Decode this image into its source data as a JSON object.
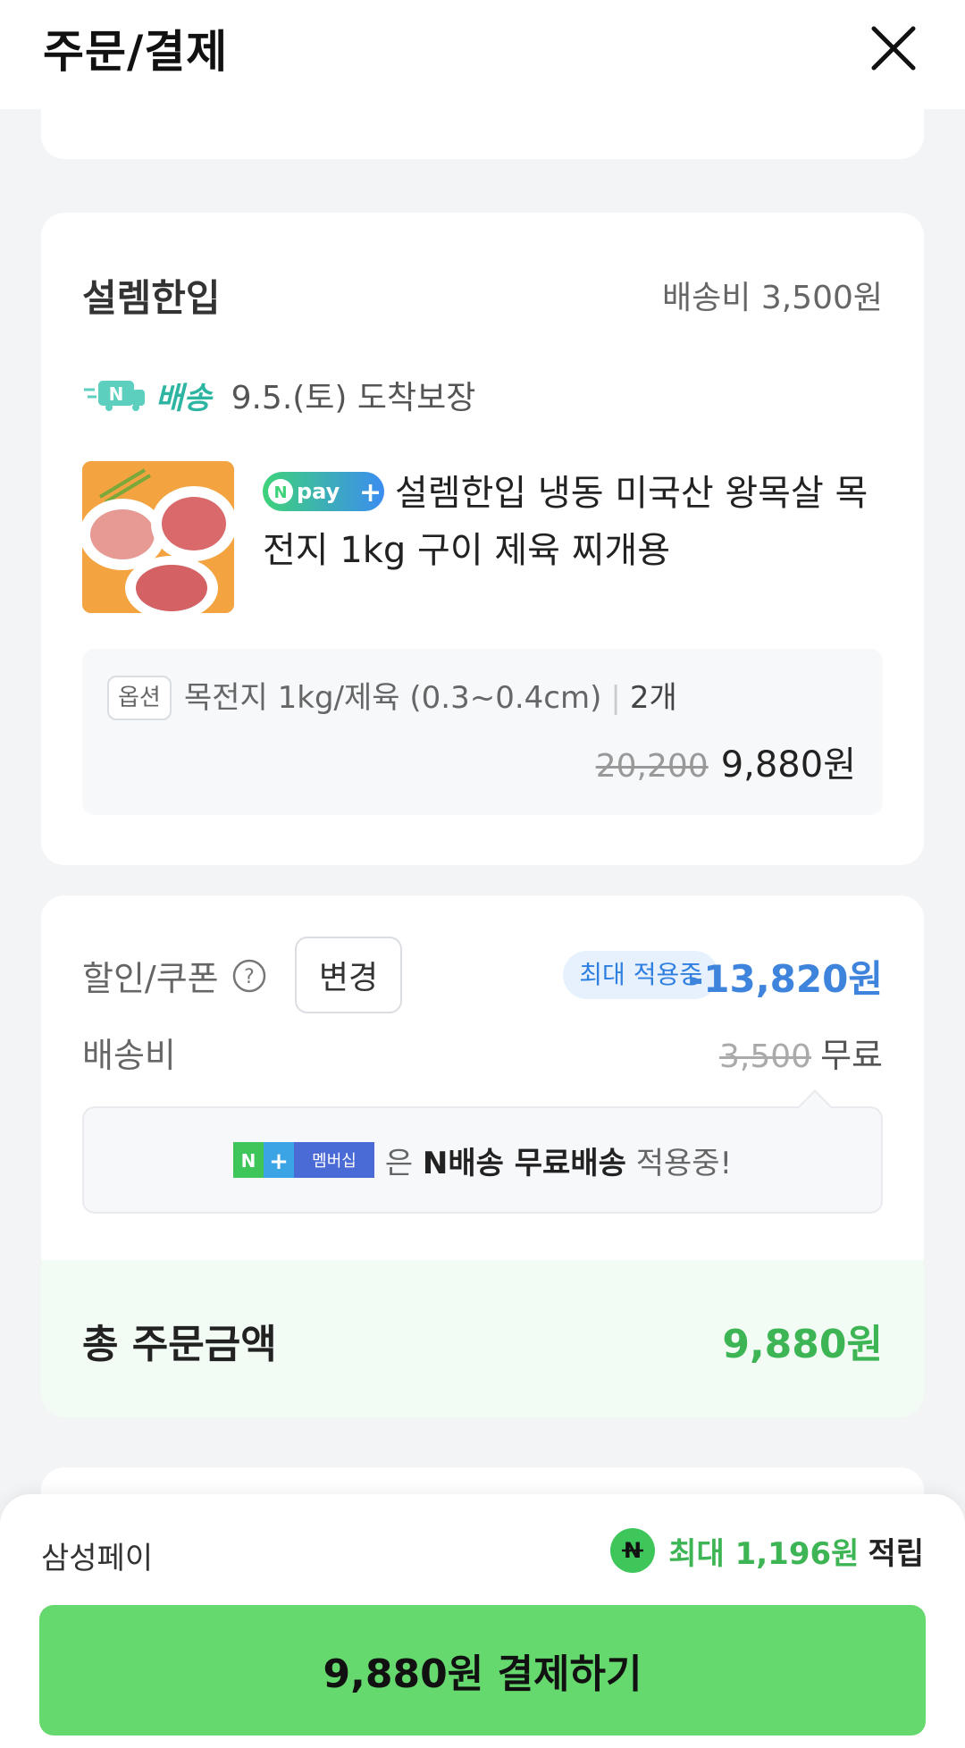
{
  "header": {
    "title": "주문/결제"
  },
  "seller": {
    "name": "설렘한입",
    "shipping_fee": "배송비 3,500원",
    "delivery_brand": "배송",
    "delivery_date": "9.5.(토) 도착보장"
  },
  "product": {
    "title": "설렘한입 냉동 미국산 왕목살 목전지 1kg 구이 제육 찌개용",
    "option_tag": "옵션",
    "option": "목전지 1kg/제육 (0.3~0.4cm)",
    "quantity": "2개",
    "original_price": "20,200",
    "price": "9,880원"
  },
  "discount": {
    "label": "할인/쿠폰",
    "change_label": "변경",
    "max_badge": "최대 적용중",
    "amount": "-13,820원"
  },
  "shipping": {
    "label": "배송비",
    "original": "3,500",
    "value": "무료"
  },
  "membership": {
    "badge_text": "멤버십",
    "text_prefix": "은",
    "text_bold": "N배송 무료배송",
    "text_suffix": "적용중!"
  },
  "total": {
    "label": "총 주문금액",
    "value": "9,880원"
  },
  "payment": {
    "method": "삼성페이",
    "points": "최대 1,196원",
    "points_suffix": "적립",
    "button_label": "9,880원 결제하기"
  },
  "colors": {
    "accent_green": "#3db554",
    "button_green": "#65d96d",
    "discount_blue": "#3e84dc",
    "delivery_teal": "#2eb5a2"
  }
}
